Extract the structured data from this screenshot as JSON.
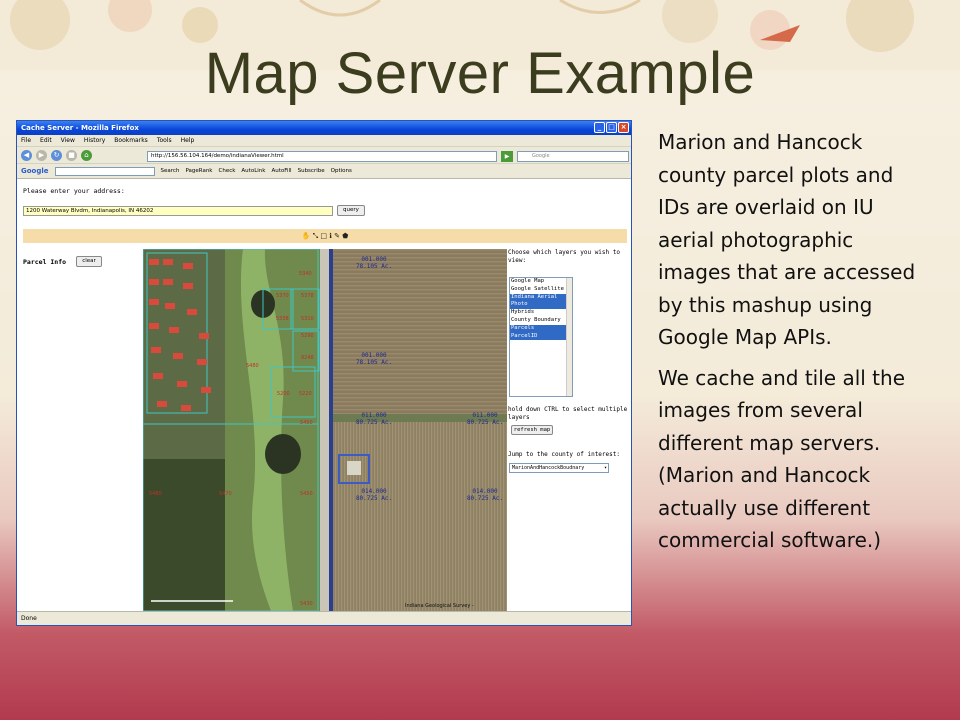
{
  "slide": {
    "title": "Map Server Example",
    "paragraphs": [
      "Marion and Hancock county parcel plots and IDs are overlaid on IU aerial photographic images that are accessed by this mashup using Google Map APIs.",
      "We  cache and tile all the images from several different map servers. (Marion and Hancock actually use different commercial software.)"
    ]
  },
  "browser": {
    "window_title": "Cache Server - Mozilla Firefox",
    "menu": [
      "File",
      "Edit",
      "View",
      "History",
      "Bookmarks",
      "Tools",
      "Help"
    ],
    "url": "http://156.56.104.164/demo/indianaViewer.html",
    "search_placeholder": "Google",
    "google_toolbar": {
      "label": "Google",
      "items": [
        "Search",
        "PageRank",
        "Check",
        "AutoLink",
        "AutoFill",
        "Subscribe",
        "Options"
      ]
    },
    "status": "Done"
  },
  "page": {
    "prompt": "Please enter your address:",
    "address_value": "1200 Waterway Blvdm, Indianapolis, IN 46202",
    "query_label": "query",
    "parcel_info_label": "Parcel Info",
    "clear_label": "clear",
    "layers_prompt": "Choose which layers you wish to view:",
    "layers": [
      {
        "label": "Google Map",
        "selected": false
      },
      {
        "label": "Google Satellite",
        "selected": false
      },
      {
        "label": "Indiana Aerial Photo",
        "selected": true
      },
      {
        "label": "Hybrids",
        "selected": false
      },
      {
        "label": "County Boundary",
        "selected": false
      },
      {
        "label": "Parcels",
        "selected": true
      },
      {
        "label": "ParcelID",
        "selected": true
      }
    ],
    "ctrl_hint": "hold down CTRL to select multiple layers",
    "refresh_label": "refresh map",
    "county_prompt": "Jump to the county of interest:",
    "county_value": "MarionAndHancockBoudnary",
    "map": {
      "parcels": [
        {
          "id": "001.000",
          "acres": "78.105 Ac."
        },
        {
          "id": "001.000",
          "acres": "78.105 Ac."
        },
        {
          "id": "011.000",
          "acres": "80.725 Ac."
        },
        {
          "id": "011.000",
          "acres": "80.725 Ac."
        },
        {
          "id": "014.000",
          "acres": "80.725 Ac."
        },
        {
          "id": "014.000",
          "acres": "80.725 Ac."
        }
      ],
      "lot_numbers": [
        "5340",
        "5370",
        "5378",
        "5338",
        "5310",
        "5290",
        "9248",
        "5200",
        "5480",
        "5450",
        "5480",
        "5450",
        "5470",
        "5430",
        "5220"
      ],
      "credit": "Indiana Geological Survey -"
    }
  }
}
